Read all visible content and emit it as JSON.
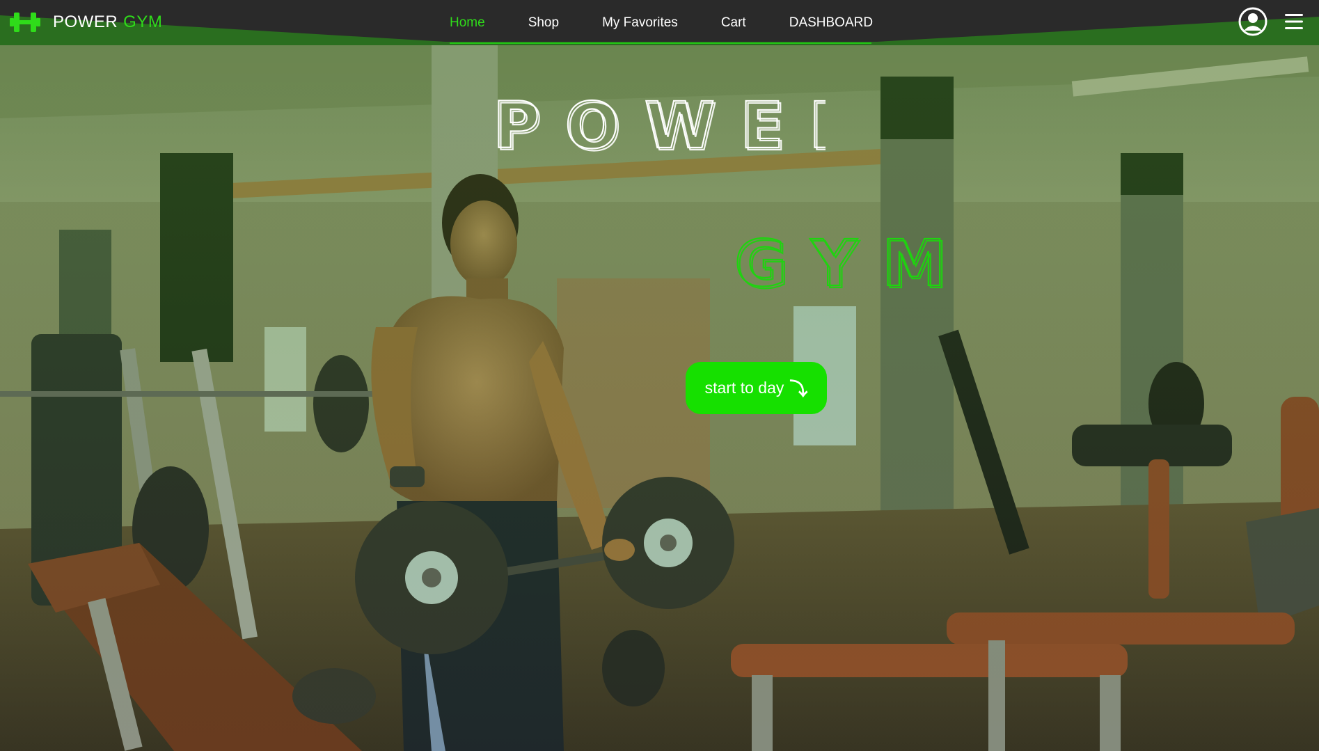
{
  "brand": {
    "name_part1": "POWER",
    "name_part2": "GYM",
    "logo_icon": "dumbbell-icon"
  },
  "nav": {
    "items": [
      {
        "label": "Home",
        "active": true
      },
      {
        "label": "Shop",
        "active": false
      },
      {
        "label": "My Favorites",
        "active": false
      },
      {
        "label": "Cart",
        "active": false
      },
      {
        "label": "DASHBOARD",
        "active": false
      }
    ],
    "profile_icon": "user-circle-icon",
    "menu_icon": "hamburger-menu-icon"
  },
  "hero": {
    "title_line1": "POWER",
    "title_line2": "GYM",
    "cta_label": "start to day",
    "cta_icon": "arrow-down-icon",
    "cta_arrow_glyph": "⤵"
  },
  "colors": {
    "accent_green": "#2fdc1a",
    "button_green": "#16e000",
    "navbar_green": "#2a6e1f",
    "navbar_dark": "#2a2a2a",
    "title_white": "#ffffff"
  }
}
